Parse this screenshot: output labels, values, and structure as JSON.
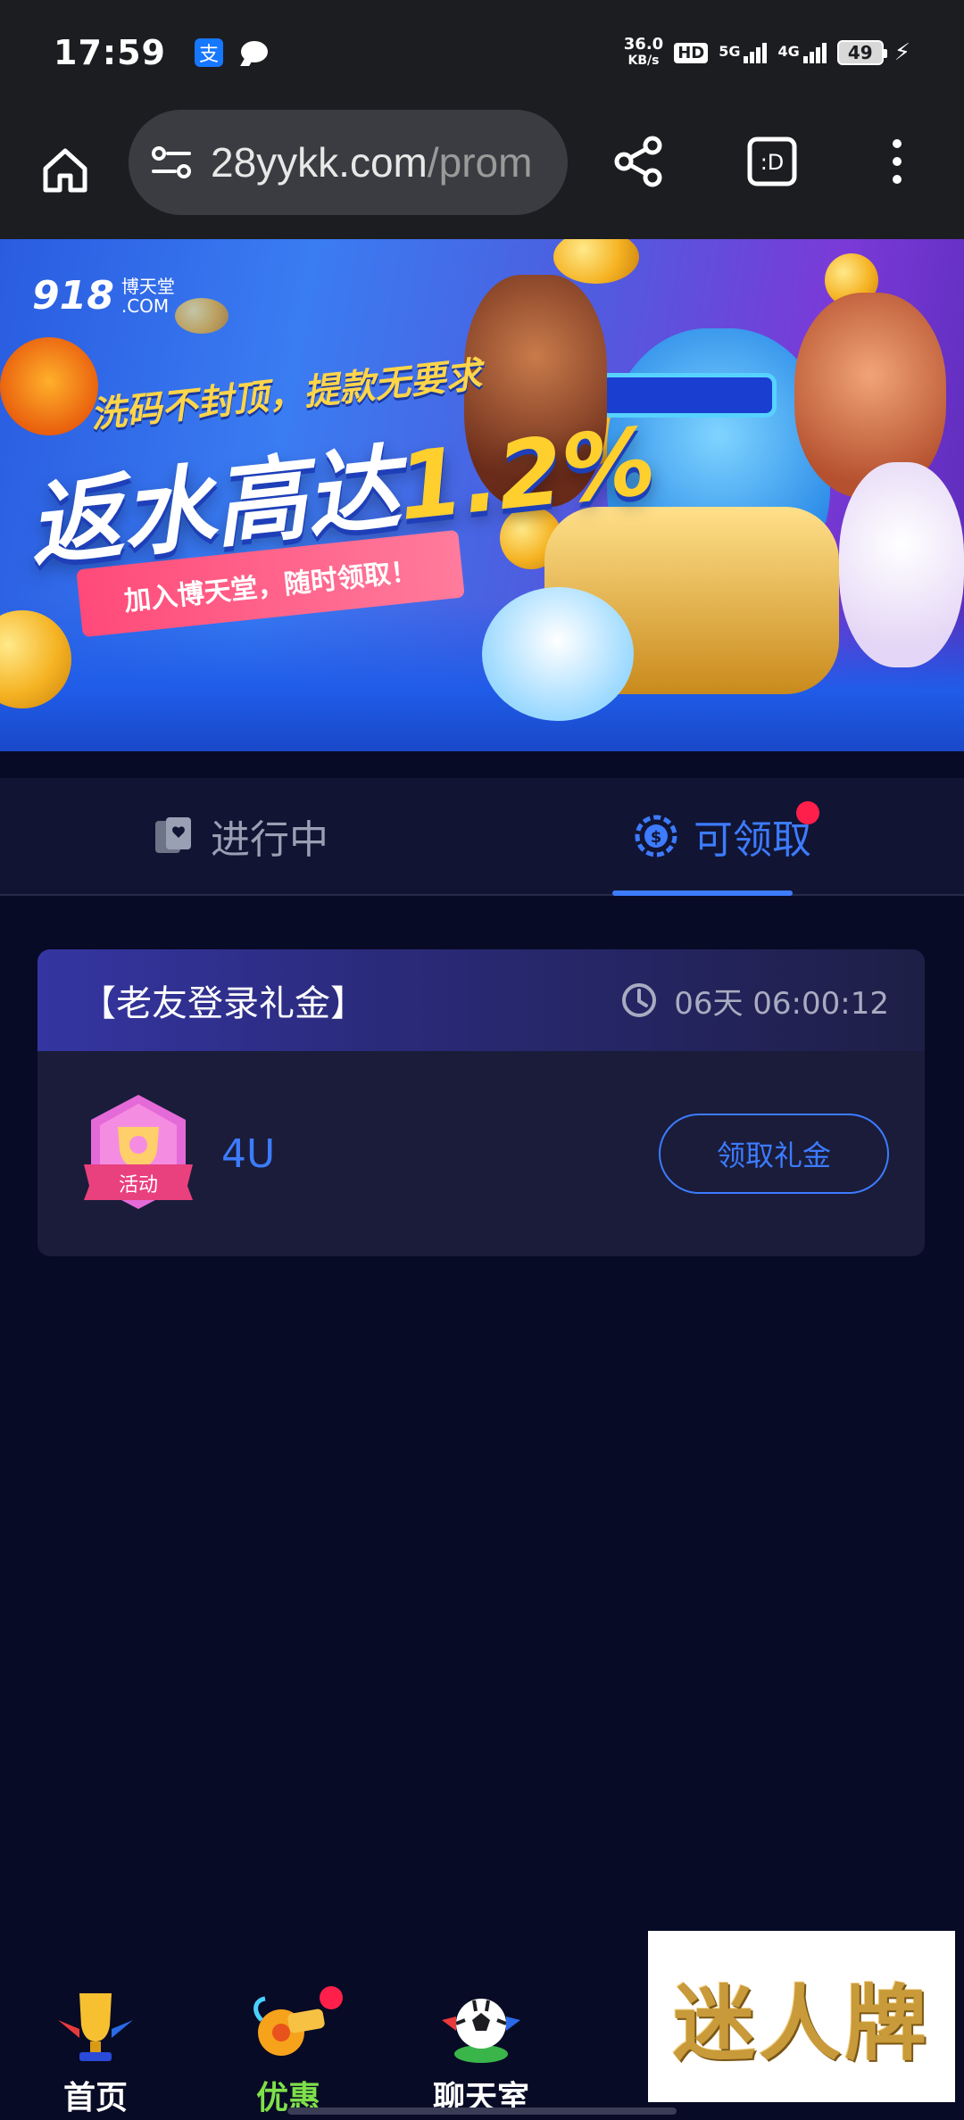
{
  "status_bar": {
    "time": "17:59",
    "net_speed_value": "36.0",
    "net_speed_unit": "KB/s",
    "hd_label": "HD",
    "signal1_label": "5G",
    "signal2_label": "4G",
    "battery": "49",
    "icons": [
      "alipay-icon",
      "message-icon",
      "signal-icon",
      "battery-icon",
      "charging-icon"
    ]
  },
  "browser": {
    "url_domain": "28yykk.com",
    "url_path": "/prom",
    "icons": [
      "home-icon",
      "site-settings-icon",
      "share-icon",
      "desktop-mode-icon",
      "more-icon"
    ]
  },
  "banner": {
    "logo_number": "918",
    "logo_site": "博天堂",
    "logo_domain": ".COM",
    "subtitle": "洗码不封顶，提款无要求",
    "headline": "返水高达",
    "headline_percent": "1.2%",
    "ribbon": "加入博天堂，随时领取！"
  },
  "tabs": [
    {
      "label": "进行中",
      "icon": "cards-icon",
      "active": false
    },
    {
      "label": "可领取",
      "icon": "coin-icon",
      "active": true,
      "has_dot": true
    }
  ],
  "card": {
    "title": "【老友登录礼金】",
    "countdown": "06天 06:00:12",
    "badge_text": "活动",
    "reward": "4U",
    "claim_label": "领取礼金"
  },
  "bottom_nav": [
    {
      "label": "首页",
      "icon": "trophy-icon",
      "active": false
    },
    {
      "label": "优惠",
      "icon": "whistle-icon",
      "active": true,
      "has_dot": true
    },
    {
      "label": "聊天室",
      "icon": "soccer-ball-icon",
      "active": false
    }
  ],
  "watermark": "迷人牌",
  "colors": {
    "page_bg": "#080b25",
    "accent_blue": "#3d7bff",
    "active_nav": "#7ee04a",
    "notification_red": "#ff1f4b"
  }
}
